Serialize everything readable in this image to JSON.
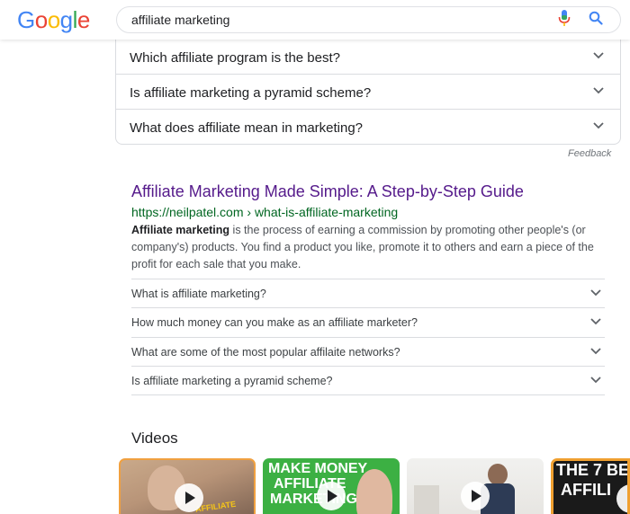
{
  "logo": {
    "letters": [
      "G",
      "o",
      "o",
      "g",
      "l",
      "e"
    ],
    "colors": [
      "#4285F4",
      "#EA4335",
      "#FBBC05",
      "#4285F4",
      "#34A853",
      "#EA4335"
    ]
  },
  "search": {
    "query": "affiliate marketing"
  },
  "paa": {
    "questions": [
      "Which affiliate program is the best?",
      "Is affiliate marketing a pyramid scheme?",
      "What does affiliate mean in marketing?"
    ],
    "feedback": "Feedback"
  },
  "result": {
    "title": "Affiliate Marketing Made Simple: A Step-by-Step Guide",
    "url": "https://neilpatel.com › what-is-affiliate-marketing",
    "snippet_bold": "Affiliate marketing",
    "snippet_rest": " is the process of earning a commission by promoting other people's (or company's) products. You find a product you like, promote it to others and earn a piece of the profit for each sale that you make.",
    "faqs": [
      "What is affiliate marketing?",
      "How much money can you make as an affiliate marketer?",
      "What are some of the most popular affilaite networks?",
      "Is affiliate marketing a pyramid scheme?"
    ]
  },
  "videos": {
    "heading": "Videos",
    "thumbs": [
      {
        "caption": "AFFILIATE MARKETING"
      },
      {
        "caption_l1": "MAKE MONEY",
        "caption_l2": "AFFILIATE",
        "caption_l3": "MARKETING"
      },
      {
        "caption": ""
      },
      {
        "caption_l1": "THE 7 BES",
        "caption_l2": "AFFILI"
      }
    ]
  },
  "colors": {
    "link_title": "#551a8b",
    "url_green": "#006621",
    "accent_blue": "#4285F4"
  }
}
